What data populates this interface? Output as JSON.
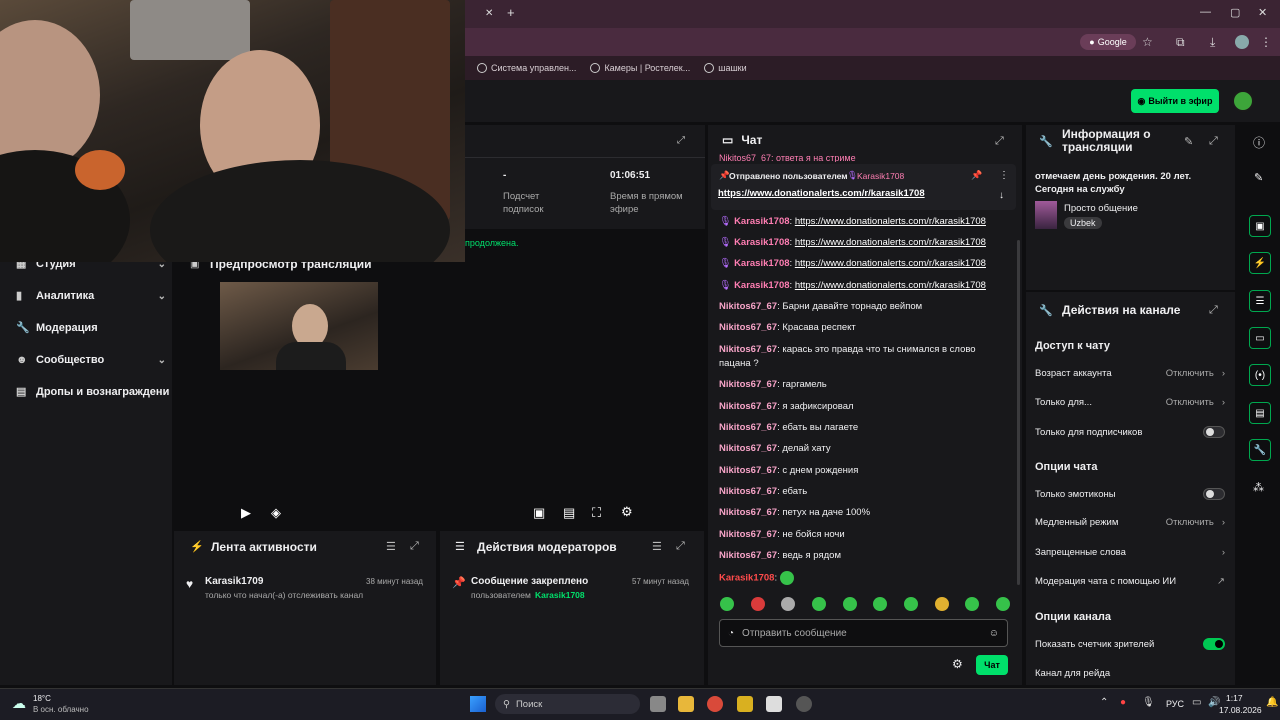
{
  "browser": {
    "bookmarks": [
      "Система управлен...",
      "Камеры | Ростелек...",
      "шашки"
    ],
    "google_chip": "Google"
  },
  "header": {
    "go_live": "Выйти в эфир"
  },
  "sidebar": {
    "items": [
      {
        "label": "Студия",
        "chev": true
      },
      {
        "label": "Аналитика",
        "chev": true
      },
      {
        "label": "Модерация",
        "chev": false
      },
      {
        "label": "Сообщество",
        "chev": true
      },
      {
        "label": "Дропы и вознаграждени",
        "chev": false
      }
    ]
  },
  "stats": {
    "subs_value": "-",
    "subs_label": "Подсчет подписок",
    "time_value": "01:06:51",
    "time_label": "Время в прямом эфире",
    "ticker": "продолжена."
  },
  "preview": {
    "title": "Предпросмотр трансляции"
  },
  "activity": {
    "title": "Лента активности",
    "user": "Karasik1709",
    "time": "38 минут назад",
    "text": "только что начал(-а) отслеживать канал"
  },
  "mod": {
    "title": "Действия модераторов",
    "event": "Сообщение закреплено",
    "time": "57 минут назад",
    "by": "пользователем",
    "user": "Karasik1708"
  },
  "chat": {
    "title": "Чат",
    "top_cut": "Nikitos67_67: ответа я на стриме",
    "pinned_label": "Отправлено пользователем",
    "pinned_user": "Karasik1708",
    "pinned_link": "https://www.donationalerts.com/r/karasik1708",
    "messages": [
      {
        "user": "Karasik1708",
        "text": "https://www.donationalerts.com/r/karasik1708",
        "link": true,
        "mic": true
      },
      {
        "user": "Karasik1708",
        "text": "https://www.donationalerts.com/r/karasik1708",
        "link": true,
        "mic": true
      },
      {
        "user": "Karasik1708",
        "text": "https://www.donationalerts.com/r/karasik1708",
        "link": true,
        "mic": true
      },
      {
        "user": "Karasik1708",
        "text": "https://www.donationalerts.com/r/karasik1708",
        "link": true,
        "mic": true
      },
      {
        "user": "Nikitos67_67",
        "text": "Барни давайте торнадо вейпом"
      },
      {
        "user": "Nikitos67_67",
        "text": "Красава респект"
      },
      {
        "user": "Nikitos67_67",
        "text": "карась это правда что ты снимался в слово пацана ?"
      },
      {
        "user": "Nikitos67_67",
        "text": "гаргамель"
      },
      {
        "user": "Nikitos67_67",
        "text": "я зафиксировал"
      },
      {
        "user": "Nikitos67_67",
        "text": "ебать вы лагаете"
      },
      {
        "user": "Nikitos67_67",
        "text": "делай хату"
      },
      {
        "user": "Nikitos67_67",
        "text": "с днем рождения"
      },
      {
        "user": "Nikitos67_67",
        "text": "ебать"
      },
      {
        "user": "Nikitos67_67",
        "text": "петух на даче 100%"
      },
      {
        "user": "Nikitos67_67",
        "text": "не бойся ночи"
      },
      {
        "user": "Nikitos67_67",
        "text": "ведь я рядом"
      },
      {
        "user": "Karasik1708",
        "text": "",
        "red": true
      }
    ],
    "input_placeholder": "Отправить сообщение",
    "send": "Чат"
  },
  "info": {
    "title": "Информация о трансляции",
    "desc": "отмечаем день рождения. 20 лет. Сегодня на службу",
    "category": "Просто общение",
    "tag": "Uzbek"
  },
  "actions": {
    "title": "Действия на канале",
    "chat_access": "Доступ к чату",
    "account_age": "Возраст аккаунта",
    "account_age_val": "Отключить",
    "only_for": "Только для...",
    "only_for_val": "Отключить",
    "subs_only": "Только для подписчиков",
    "chat_options": "Опции чата",
    "emotes_only": "Только эмотиконы",
    "slow_mode": "Медленный режим",
    "slow_mode_val": "Отключить",
    "banned_words": "Запрещенные слова",
    "ai_mod": "Модерация чата с помощью ИИ",
    "channel_options": "Опции канала",
    "viewer_count": "Показать счетчик зрителей",
    "raid": "Канал для рейда"
  },
  "taskbar": {
    "temp": "18°C",
    "weather": "В осн. облачно",
    "search": "Поиск",
    "lang": "РУС",
    "time": "1:17",
    "date": "17.08.2026"
  }
}
